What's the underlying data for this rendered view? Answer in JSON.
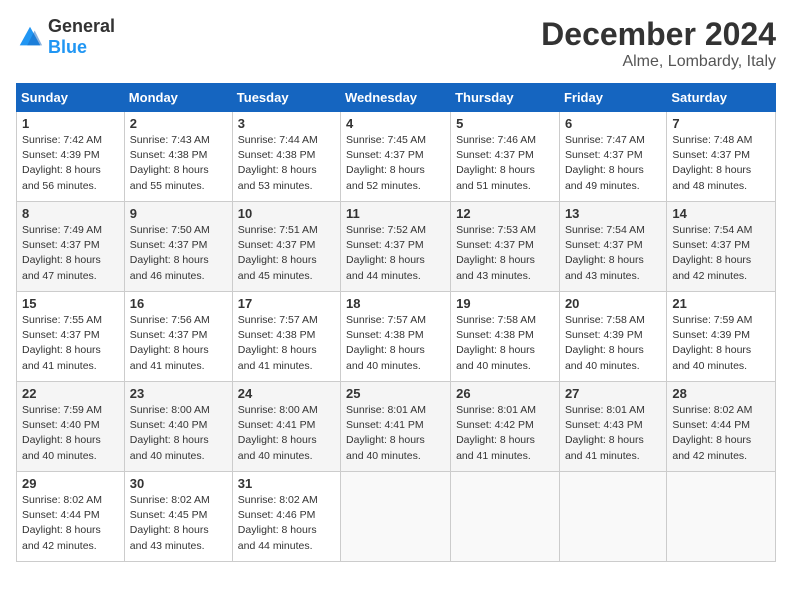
{
  "logo": {
    "text_general": "General",
    "text_blue": "Blue"
  },
  "header": {
    "month": "December 2024",
    "location": "Alme, Lombardy, Italy"
  },
  "weekdays": [
    "Sunday",
    "Monday",
    "Tuesday",
    "Wednesday",
    "Thursday",
    "Friday",
    "Saturday"
  ],
  "weeks": [
    [
      {
        "day": "1",
        "sunrise": "7:42 AM",
        "sunset": "4:39 PM",
        "daylight": "8 hours and 56 minutes."
      },
      {
        "day": "2",
        "sunrise": "7:43 AM",
        "sunset": "4:38 PM",
        "daylight": "8 hours and 55 minutes."
      },
      {
        "day": "3",
        "sunrise": "7:44 AM",
        "sunset": "4:38 PM",
        "daylight": "8 hours and 53 minutes."
      },
      {
        "day": "4",
        "sunrise": "7:45 AM",
        "sunset": "4:37 PM",
        "daylight": "8 hours and 52 minutes."
      },
      {
        "day": "5",
        "sunrise": "7:46 AM",
        "sunset": "4:37 PM",
        "daylight": "8 hours and 51 minutes."
      },
      {
        "day": "6",
        "sunrise": "7:47 AM",
        "sunset": "4:37 PM",
        "daylight": "8 hours and 49 minutes."
      },
      {
        "day": "7",
        "sunrise": "7:48 AM",
        "sunset": "4:37 PM",
        "daylight": "8 hours and 48 minutes."
      }
    ],
    [
      {
        "day": "8",
        "sunrise": "7:49 AM",
        "sunset": "4:37 PM",
        "daylight": "8 hours and 47 minutes."
      },
      {
        "day": "9",
        "sunrise": "7:50 AM",
        "sunset": "4:37 PM",
        "daylight": "8 hours and 46 minutes."
      },
      {
        "day": "10",
        "sunrise": "7:51 AM",
        "sunset": "4:37 PM",
        "daylight": "8 hours and 45 minutes."
      },
      {
        "day": "11",
        "sunrise": "7:52 AM",
        "sunset": "4:37 PM",
        "daylight": "8 hours and 44 minutes."
      },
      {
        "day": "12",
        "sunrise": "7:53 AM",
        "sunset": "4:37 PM",
        "daylight": "8 hours and 43 minutes."
      },
      {
        "day": "13",
        "sunrise": "7:54 AM",
        "sunset": "4:37 PM",
        "daylight": "8 hours and 43 minutes."
      },
      {
        "day": "14",
        "sunrise": "7:54 AM",
        "sunset": "4:37 PM",
        "daylight": "8 hours and 42 minutes."
      }
    ],
    [
      {
        "day": "15",
        "sunrise": "7:55 AM",
        "sunset": "4:37 PM",
        "daylight": "8 hours and 41 minutes."
      },
      {
        "day": "16",
        "sunrise": "7:56 AM",
        "sunset": "4:37 PM",
        "daylight": "8 hours and 41 minutes."
      },
      {
        "day": "17",
        "sunrise": "7:57 AM",
        "sunset": "4:38 PM",
        "daylight": "8 hours and 41 minutes."
      },
      {
        "day": "18",
        "sunrise": "7:57 AM",
        "sunset": "4:38 PM",
        "daylight": "8 hours and 40 minutes."
      },
      {
        "day": "19",
        "sunrise": "7:58 AM",
        "sunset": "4:38 PM",
        "daylight": "8 hours and 40 minutes."
      },
      {
        "day": "20",
        "sunrise": "7:58 AM",
        "sunset": "4:39 PM",
        "daylight": "8 hours and 40 minutes."
      },
      {
        "day": "21",
        "sunrise": "7:59 AM",
        "sunset": "4:39 PM",
        "daylight": "8 hours and 40 minutes."
      }
    ],
    [
      {
        "day": "22",
        "sunrise": "7:59 AM",
        "sunset": "4:40 PM",
        "daylight": "8 hours and 40 minutes."
      },
      {
        "day": "23",
        "sunrise": "8:00 AM",
        "sunset": "4:40 PM",
        "daylight": "8 hours and 40 minutes."
      },
      {
        "day": "24",
        "sunrise": "8:00 AM",
        "sunset": "4:41 PM",
        "daylight": "8 hours and 40 minutes."
      },
      {
        "day": "25",
        "sunrise": "8:01 AM",
        "sunset": "4:41 PM",
        "daylight": "8 hours and 40 minutes."
      },
      {
        "day": "26",
        "sunrise": "8:01 AM",
        "sunset": "4:42 PM",
        "daylight": "8 hours and 41 minutes."
      },
      {
        "day": "27",
        "sunrise": "8:01 AM",
        "sunset": "4:43 PM",
        "daylight": "8 hours and 41 minutes."
      },
      {
        "day": "28",
        "sunrise": "8:02 AM",
        "sunset": "4:44 PM",
        "daylight": "8 hours and 42 minutes."
      }
    ],
    [
      {
        "day": "29",
        "sunrise": "8:02 AM",
        "sunset": "4:44 PM",
        "daylight": "8 hours and 42 minutes."
      },
      {
        "day": "30",
        "sunrise": "8:02 AM",
        "sunset": "4:45 PM",
        "daylight": "8 hours and 43 minutes."
      },
      {
        "day": "31",
        "sunrise": "8:02 AM",
        "sunset": "4:46 PM",
        "daylight": "8 hours and 44 minutes."
      },
      null,
      null,
      null,
      null
    ]
  ]
}
